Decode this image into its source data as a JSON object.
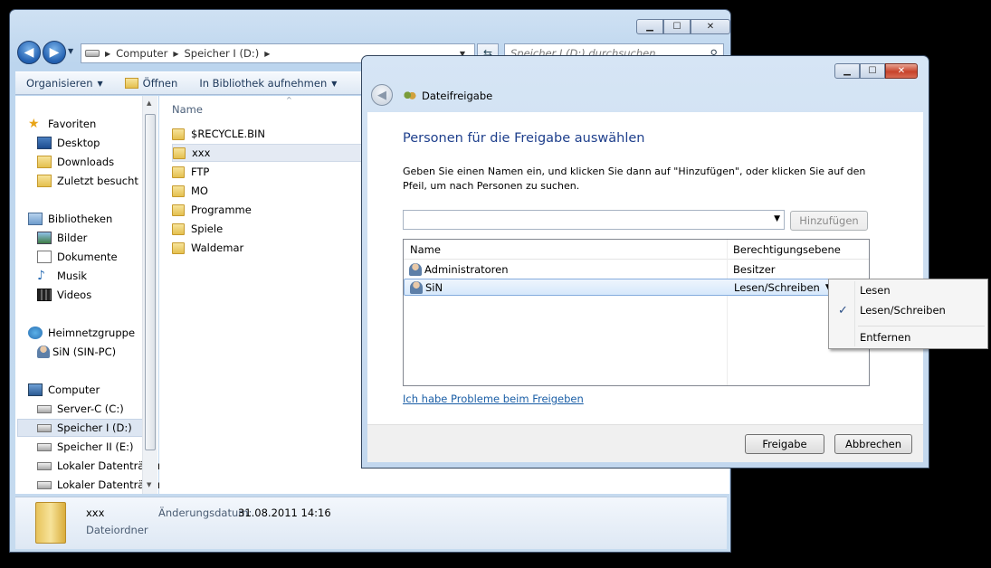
{
  "explorer": {
    "address": {
      "parts": [
        "Computer",
        "Speicher I (D:)"
      ]
    },
    "search_placeholder": "Speicher I (D:) durchsuchen",
    "toolbar": {
      "organize": "Organisieren",
      "open": "Öffnen",
      "library": "In Bibliothek aufnehmen"
    },
    "nav": {
      "favorites": "Favoriten",
      "desktop": "Desktop",
      "downloads": "Downloads",
      "recent": "Zuletzt besucht",
      "libraries": "Bibliotheken",
      "pictures": "Bilder",
      "documents": "Dokumente",
      "music": "Musik",
      "videos": "Videos",
      "homegroup": "Heimnetzgruppe",
      "homegroup_user": "SiN (SIN-PC)",
      "computer": "Computer",
      "drive_c": "Server-C (C:)",
      "drive_d": "Speicher I (D:)",
      "drive_e": "Speicher II (E:)",
      "local1": "Lokaler Datenträger",
      "local2": "Lokaler Datenträger"
    },
    "files": {
      "column_name": "Name",
      "items": [
        "$RECYCLE.BIN",
        "xxx",
        "FTP",
        "MO",
        "Programme",
        "Spiele",
        "Waldemar"
      ]
    },
    "details": {
      "name": "xxx",
      "type": "Dateiordner",
      "modified_label": "Änderungsdatum:",
      "modified_value": "31.08.2011 14:16"
    }
  },
  "dialog": {
    "title": "Dateifreigabe",
    "heading": "Personen für die Freigabe auswählen",
    "instruction": "Geben Sie einen Namen ein, und klicken Sie dann auf \"Hinzufügen\", oder klicken Sie auf den Pfeil, um nach Personen zu suchen.",
    "add_button": "Hinzufügen",
    "list": {
      "col_name": "Name",
      "col_permission": "Berechtigungsebene",
      "rows": [
        {
          "name": "Administratoren",
          "permission": "Besitzer"
        },
        {
          "name": "SiN",
          "permission": "Lesen/Schreiben"
        }
      ]
    },
    "help_link": "Ich habe Probleme beim Freigeben",
    "share_button": "Freigabe",
    "cancel_button": "Abbrechen"
  },
  "context_menu": {
    "items": [
      "Lesen",
      "Lesen/Schreiben",
      "Entfernen"
    ],
    "checked": "Lesen/Schreiben"
  },
  "colors": {
    "heading": "#1e3f8c",
    "link": "#1a5ea6",
    "close_red": "#c7432b"
  }
}
